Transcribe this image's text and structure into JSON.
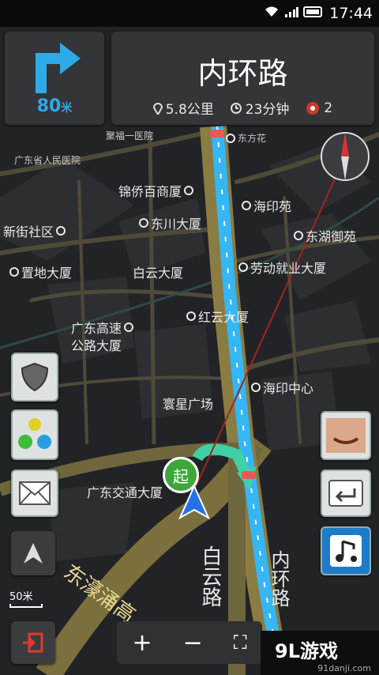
{
  "status": {
    "time": "17:44"
  },
  "nav": {
    "turn_distance_value": "80",
    "turn_distance_unit": "米",
    "road_name": "内环路",
    "remaining_distance": "5.8公里",
    "remaining_time": "23分钟",
    "cameras": "2"
  },
  "map": {
    "pois": [
      "广东省人民医院",
      "锦侨百商厦",
      "东川大厦",
      "新街社区",
      "置地大厦",
      "白云大厦",
      "红云大厦",
      "广东高速",
      "公路大厦",
      "寰星广场",
      "广东交通大厦",
      "东方花",
      "海印苑",
      "东湖御苑",
      "劳动就业大厦",
      "海印中心"
    ],
    "roads": [
      "东濠涌高",
      "白云路",
      "内环路"
    ],
    "start_label": "起",
    "scale": "50米"
  },
  "zoom": {
    "plus": "+",
    "minus": "−",
    "fullscreen": "⛶"
  },
  "watermark": {
    "title": "9L游戏",
    "site": "91danji.com"
  },
  "colors": {
    "accent": "#2fa9e8",
    "route": "#35b6f5",
    "turn": "#3fd0a6"
  }
}
